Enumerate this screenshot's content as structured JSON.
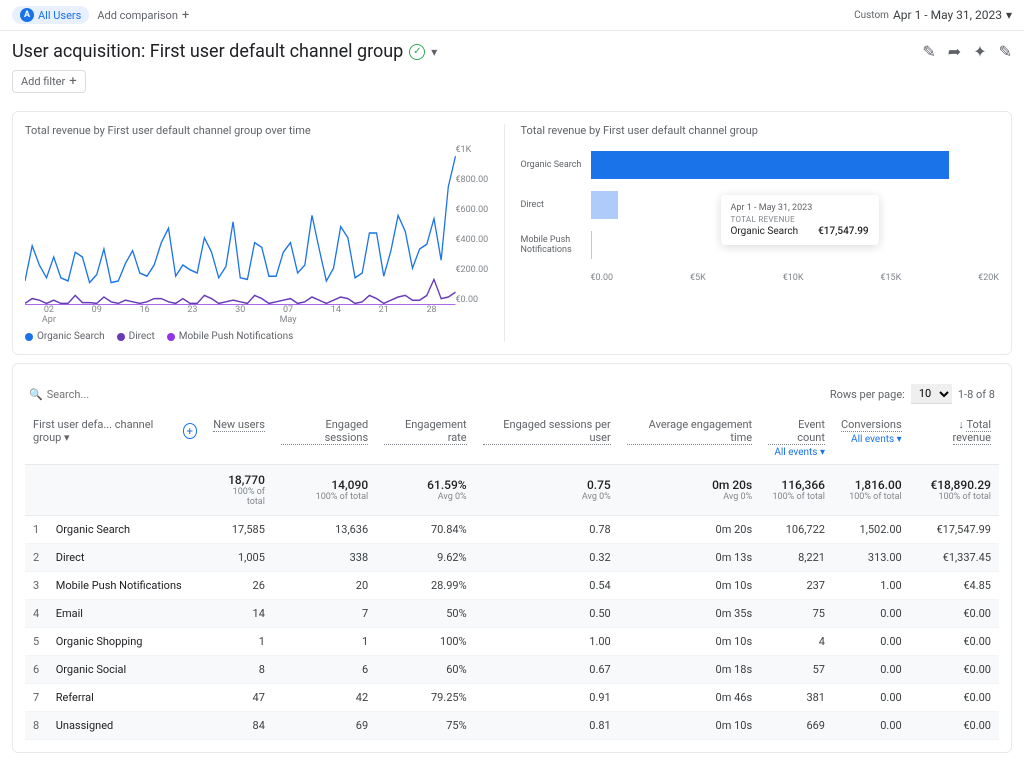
{
  "topbar": {
    "all_users": "All Users",
    "all_users_badge": "A",
    "add_comparison": "Add comparison",
    "custom_label": "Custom",
    "date_range": "Apr 1 - May 31, 2023"
  },
  "title": "User acquisition: First user default channel group",
  "add_filter": "Add filter",
  "chart_data": [
    {
      "type": "line",
      "title": "Total revenue by First user default channel group over time",
      "xlabel": "",
      "ylabel": "",
      "ylim": [
        0,
        1000
      ],
      "y_ticks": [
        "€1K",
        "€800.00",
        "€600.00",
        "€400.00",
        "€200.00",
        "€0.00"
      ],
      "x_ticks": [
        "02 Apr",
        "09",
        "16",
        "23",
        "30",
        "07 May",
        "14",
        "21",
        "28"
      ],
      "series": [
        {
          "name": "Organic Search",
          "color": "#1a73e8",
          "values": [
            150,
            370,
            250,
            170,
            300,
            170,
            150,
            330,
            300,
            140,
            190,
            350,
            140,
            150,
            260,
            340,
            200,
            180,
            250,
            390,
            480,
            180,
            250,
            220,
            200,
            420,
            330,
            170,
            240,
            520,
            170,
            160,
            390,
            360,
            180,
            180,
            330,
            390,
            200,
            250,
            560,
            350,
            150,
            230,
            490,
            420,
            170,
            200,
            450,
            450,
            180,
            340,
            560,
            460,
            230,
            350,
            380,
            540,
            280,
            740,
            930
          ]
        },
        {
          "name": "Direct",
          "color": "#673ab7",
          "values": [
            10,
            40,
            30,
            10,
            30,
            10,
            10,
            60,
            15,
            15,
            10,
            50,
            20,
            10,
            30,
            20,
            10,
            20,
            40,
            40,
            20,
            10,
            40,
            10,
            10,
            60,
            40,
            10,
            20,
            30,
            20,
            10,
            60,
            40,
            10,
            20,
            30,
            40,
            10,
            20,
            50,
            30,
            10,
            30,
            50,
            40,
            10,
            20,
            60,
            40,
            10,
            30,
            50,
            60,
            30,
            30,
            60,
            160,
            40,
            50,
            80
          ]
        },
        {
          "name": "Mobile Push Notifications",
          "color": "#9334e6",
          "values": [
            0,
            0,
            0,
            0,
            0,
            0,
            0,
            0,
            0,
            0,
            0,
            0,
            0,
            0,
            0,
            0,
            0,
            0,
            0,
            0,
            0,
            0,
            0,
            0,
            0,
            0,
            0,
            0,
            0,
            0,
            0,
            0,
            0,
            0,
            0,
            0,
            0,
            0,
            0,
            0,
            0,
            0,
            0,
            0,
            0,
            0,
            0,
            0,
            0,
            0,
            0,
            0,
            0,
            0,
            0,
            0,
            0,
            0,
            0,
            0,
            0
          ]
        }
      ]
    },
    {
      "type": "bar",
      "title": "Total revenue by First user default channel group",
      "orientation": "horizontal",
      "xlim": [
        0,
        20000
      ],
      "x_ticks": [
        "€0.00",
        "€5K",
        "€10K",
        "€15K",
        "€20K"
      ],
      "categories": [
        "Organic Search",
        "Direct",
        "Mobile Push Notifications"
      ],
      "values": [
        17547.99,
        1337.45,
        4.85
      ],
      "tooltip": {
        "date": "Apr 1 - May 31, 2023",
        "label": "TOTAL REVENUE",
        "name": "Organic Search",
        "value": "€17,547.99"
      }
    }
  ],
  "legend": [
    {
      "label": "Organic Search",
      "color": "#1a73e8"
    },
    {
      "label": "Direct",
      "color": "#673ab7"
    },
    {
      "label": "Mobile Push Notifications",
      "color": "#9334e6"
    }
  ],
  "table": {
    "search_placeholder": "Search...",
    "rows_per_page_label": "Rows per page:",
    "rows_per_page_value": "10",
    "page_info": "1-8 of 8",
    "first_col_label": "First user defa... channel group",
    "columns": [
      {
        "label": "New users"
      },
      {
        "label": "Engaged sessions"
      },
      {
        "label": "Engagement rate"
      },
      {
        "label": "Engaged sessions per user"
      },
      {
        "label": "Average engagement time"
      },
      {
        "label": "Event count",
        "dropdown": "All events"
      },
      {
        "label": "Conversions",
        "dropdown": "All events"
      },
      {
        "label": "Total revenue",
        "sorted": true
      }
    ],
    "totals": [
      {
        "val": "18,770",
        "pct": "100% of total"
      },
      {
        "val": "14,090",
        "pct": "100% of total"
      },
      {
        "val": "61.59%",
        "pct": "Avg 0%"
      },
      {
        "val": "0.75",
        "pct": "Avg 0%"
      },
      {
        "val": "0m 20s",
        "pct": "Avg 0%"
      },
      {
        "val": "116,366",
        "pct": "100% of total"
      },
      {
        "val": "1,816.00",
        "pct": "100% of total"
      },
      {
        "val": "€18,890.29",
        "pct": "100% of total"
      }
    ],
    "rows": [
      {
        "idx": 1,
        "name": "Organic Search",
        "cells": [
          "17,585",
          "13,636",
          "70.84%",
          "0.78",
          "0m 20s",
          "106,722",
          "1,502.00",
          "€17,547.99"
        ]
      },
      {
        "idx": 2,
        "name": "Direct",
        "cells": [
          "1,005",
          "338",
          "9.62%",
          "0.32",
          "0m 13s",
          "8,221",
          "313.00",
          "€1,337.45"
        ]
      },
      {
        "idx": 3,
        "name": "Mobile Push Notifications",
        "cells": [
          "26",
          "20",
          "28.99%",
          "0.54",
          "0m 10s",
          "237",
          "1.00",
          "€4.85"
        ]
      },
      {
        "idx": 4,
        "name": "Email",
        "cells": [
          "14",
          "7",
          "50%",
          "0.50",
          "0m 35s",
          "75",
          "0.00",
          "€0.00"
        ]
      },
      {
        "idx": 5,
        "name": "Organic Shopping",
        "cells": [
          "1",
          "1",
          "100%",
          "1.00",
          "0m 10s",
          "4",
          "0.00",
          "€0.00"
        ]
      },
      {
        "idx": 6,
        "name": "Organic Social",
        "cells": [
          "8",
          "6",
          "60%",
          "0.67",
          "0m 18s",
          "57",
          "0.00",
          "€0.00"
        ]
      },
      {
        "idx": 7,
        "name": "Referral",
        "cells": [
          "47",
          "42",
          "79.25%",
          "0.91",
          "0m 46s",
          "381",
          "0.00",
          "€0.00"
        ]
      },
      {
        "idx": 8,
        "name": "Unassigned",
        "cells": [
          "84",
          "69",
          "75%",
          "0.81",
          "0m 10s",
          "669",
          "0.00",
          "€0.00"
        ]
      }
    ]
  }
}
